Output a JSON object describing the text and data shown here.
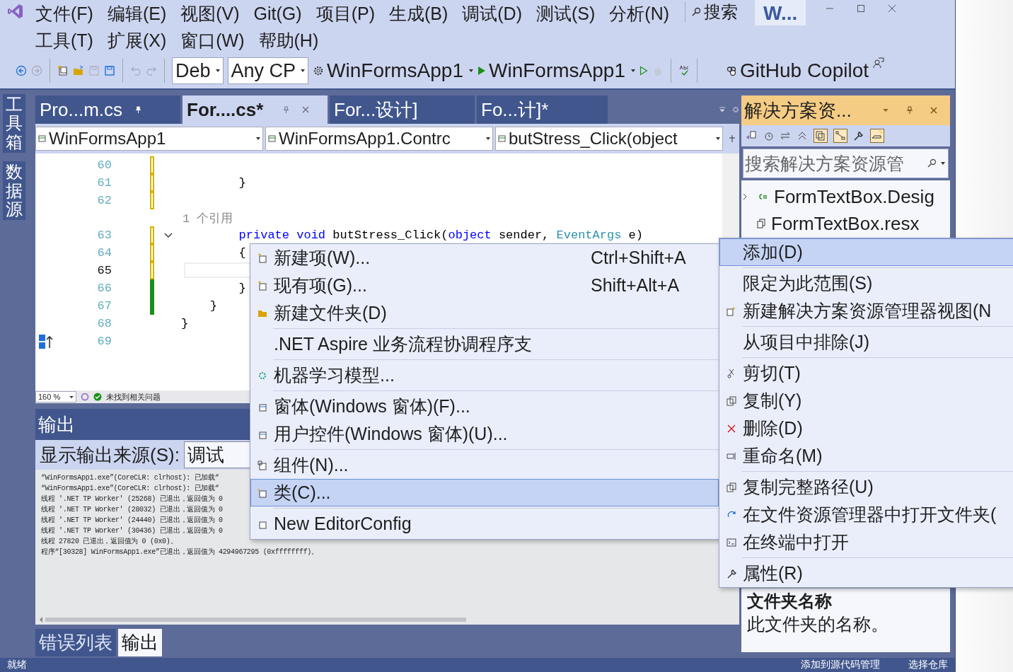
{
  "title_bar": {
    "menu_rows": [
      [
        "文件(F)",
        "编辑(E)",
        "视图(V)",
        "Git(G)",
        "项目(P)",
        "生成(B)",
        "调试(D)",
        "测试(S)",
        "分析(N)"
      ],
      [
        "工具(T)",
        "扩展(X)",
        "窗口(W)",
        "帮助(H)"
      ]
    ],
    "search": "搜索",
    "window_title": "W..."
  },
  "toolbar": {
    "configuration": "Deb",
    "platform": "Any CP",
    "startup_project": "WinFormsApp1",
    "run_target": "WinFormsApp1",
    "copilot": "GitHub Copilot"
  },
  "side_tabs": [
    "工具箱",
    "数据源"
  ],
  "document_tabs": [
    {
      "label": "Pro...m.cs",
      "selected": false,
      "pinned": true
    },
    {
      "label": "For....cs*",
      "selected": true,
      "pinned": false
    },
    {
      "label": "For...设计]",
      "selected": false,
      "pinned": false
    },
    {
      "label": "Fo...计]*",
      "selected": false,
      "pinned": false
    }
  ],
  "navigation": [
    "WinFormsApp1",
    "WinFormsApp1.Contrc",
    "butStress_Click(object"
  ],
  "code_lines": [
    {
      "kind": "line",
      "number": "60",
      "current": false,
      "changed": true,
      "saved": false
    },
    {
      "kind": "line",
      "number": "61",
      "current": false,
      "changed": true,
      "saved": false,
      "tokens": [
        {
          "text": "        }",
          "kind": "plain"
        }
      ]
    },
    {
      "kind": "line",
      "number": "62",
      "current": false,
      "changed": true,
      "saved": false
    },
    {
      "kind": "codelens",
      "text": "1 个引用"
    },
    {
      "kind": "line",
      "number": "63",
      "current": false,
      "changed": true,
      "saved": false,
      "expanded": true,
      "tokens": [
        {
          "text": "        private void",
          "kind": "keyword"
        },
        {
          "text": " butStress_Click(",
          "kind": "plain"
        },
        {
          "text": "object",
          "kind": "keyword"
        },
        {
          "text": " sender, ",
          "kind": "plain"
        },
        {
          "text": "EventArgs",
          "kind": "type"
        },
        {
          "text": " e)",
          "kind": "plain"
        }
      ]
    },
    {
      "kind": "line",
      "number": "64",
      "current": false,
      "changed": true,
      "saved": false,
      "tokens": [
        {
          "text": "        {",
          "kind": "plain"
        }
      ]
    },
    {
      "kind": "line",
      "number": "65",
      "current": true,
      "changed": true,
      "saved": false
    },
    {
      "kind": "line",
      "number": "66",
      "current": false,
      "changed": true,
      "saved": true,
      "tokens": [
        {
          "text": "        }",
          "kind": "plain"
        }
      ]
    },
    {
      "kind": "line",
      "number": "67",
      "current": false,
      "changed": true,
      "saved": true,
      "tokens": [
        {
          "text": "    }",
          "kind": "plain"
        }
      ]
    },
    {
      "kind": "line",
      "number": "68",
      "current": false,
      "changed": false,
      "tokens": [
        {
          "text": "}",
          "kind": "plain"
        }
      ]
    },
    {
      "kind": "line",
      "number": "69",
      "current": false,
      "changed": false,
      "quick_action": true
    }
  ],
  "editor_status": {
    "zoom": "160 %",
    "issues": "未找到相关问题"
  },
  "output": {
    "title": "输出",
    "source_label": "显示输出来源(S):",
    "source": "调试",
    "lines": [
      "“WinFormsApp1.exe”(CoreCLR: clrhost): 已加载“",
      "“WinFormsApp1.exe”(CoreCLR: clrhost): 已加载“",
      "线程 '.NET TP Worker' (25268) 已退出，返回值为 0",
      "线程 '.NET TP Worker' (28032) 已退出，返回值为 0",
      "线程 '.NET TP Worker' (24440) 已退出，返回值为 0",
      "线程 '.NET TP Worker' (30436) 已退出，返回值为 0",
      "线程 27820 已退出，返回值为 0 (0x0)。",
      "程序“[30328] WinFormsApp1.exe”已退出，返回值为 4294967295 (0xffffffff)。"
    ]
  },
  "bottom_tabs": [
    {
      "label": "错误列表",
      "selected": false
    },
    {
      "label": "输出",
      "selected": true
    }
  ],
  "solution_explorer": {
    "title": "解决方案资...",
    "search_placeholder": "搜索解决方案资源管",
    "items": [
      {
        "label": "FormTextBox.Desig",
        "kind": "csharp"
      },
      {
        "label": "FormTextBox.resx",
        "kind": "resource"
      }
    ]
  },
  "properties": {
    "title": "文件夹名称",
    "description": "此文件夹的名称。"
  },
  "context_menu": {
    "items": [
      {
        "kind": "item",
        "label": "添加(D)",
        "selected": true
      },
      {
        "kind": "separator"
      },
      {
        "kind": "item",
        "label": "限定为此范围(S)",
        "selected": false
      },
      {
        "kind": "item",
        "label": "新建解决方案资源管理器视图(N",
        "selected": false
      },
      {
        "kind": "separator"
      },
      {
        "kind": "item",
        "label": "从项目中排除(J)",
        "selected": false
      },
      {
        "kind": "separator"
      },
      {
        "kind": "item",
        "label": "剪切(T)",
        "selected": false
      },
      {
        "kind": "item",
        "label": "复制(Y)",
        "selected": false
      },
      {
        "kind": "item",
        "label": "删除(D)",
        "selected": false
      },
      {
        "kind": "item",
        "label": "重命名(M)",
        "selected": false
      },
      {
        "kind": "separator"
      },
      {
        "kind": "item",
        "label": "复制完整路径(U)",
        "selected": false
      },
      {
        "kind": "item",
        "label": "在文件资源管理器中打开文件夹(",
        "selected": false
      },
      {
        "kind": "item",
        "label": "在终端中打开",
        "selected": false
      },
      {
        "kind": "separator"
      },
      {
        "kind": "item",
        "label": "属性(R)",
        "selected": false
      }
    ]
  },
  "add_submenu": {
    "items": [
      {
        "kind": "item",
        "label": "新建项(W)...",
        "shortcut": "Ctrl+Shift+A",
        "selected": false
      },
      {
        "kind": "item",
        "label": "现有项(G)...",
        "shortcut": "Shift+Alt+A",
        "selected": false
      },
      {
        "kind": "item",
        "label": "新建文件夹(D)",
        "selected": false
      },
      {
        "kind": "separator"
      },
      {
        "kind": "item",
        "label": ".NET Aspire 业务流程协调程序支",
        "selected": false
      },
      {
        "kind": "separator"
      },
      {
        "kind": "item",
        "label": "机器学习模型...",
        "selected": false
      },
      {
        "kind": "separator"
      },
      {
        "kind": "item",
        "label": "窗体(Windows 窗体)(F)...",
        "selected": false
      },
      {
        "kind": "item",
        "label": "用户控件(Windows 窗体)(U)...",
        "selected": false
      },
      {
        "kind": "separator"
      },
      {
        "kind": "item",
        "label": "组件(N)...",
        "selected": false
      },
      {
        "kind": "item",
        "label": "类(C)...",
        "selected": true
      },
      {
        "kind": "separator"
      },
      {
        "kind": "item",
        "label": "New EditorConfig",
        "selected": false
      }
    ]
  },
  "status_bar": {
    "state": "就绪",
    "source_control": "添加到源代码管理",
    "repository": "选择仓库"
  }
}
